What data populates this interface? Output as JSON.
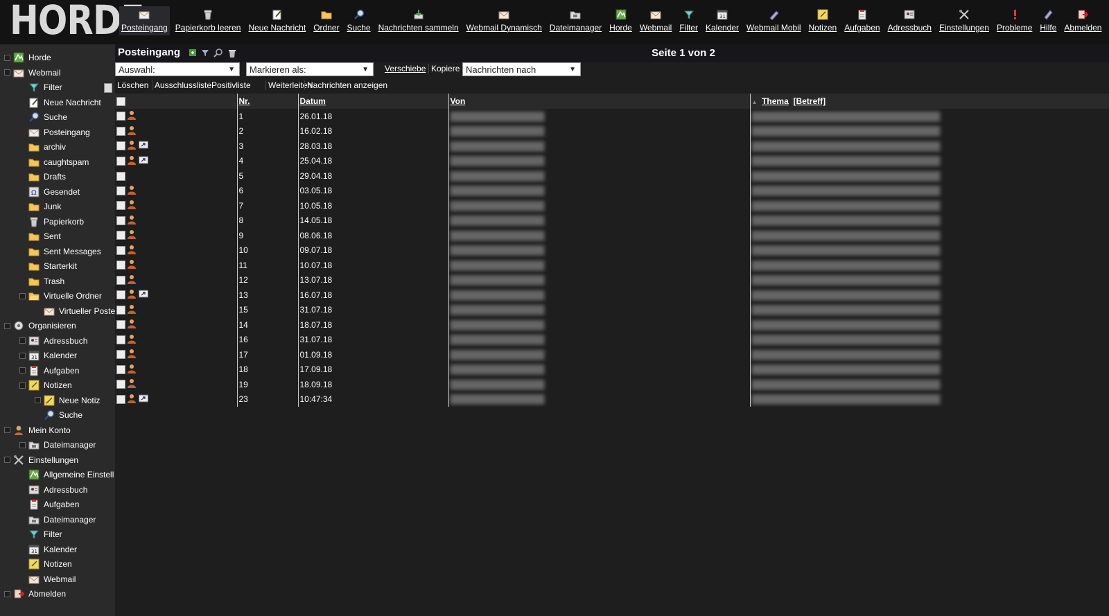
{
  "app": {
    "logo": "HORDE"
  },
  "toolbar": [
    {
      "label": "Posteingang",
      "icon": "inbox-icon",
      "active": true
    },
    {
      "label": "Papierkorb leeren",
      "icon": "trash-icon"
    },
    {
      "label": "Neue Nachricht",
      "icon": "compose-icon"
    },
    {
      "label": "Ordner",
      "icon": "folder-icon"
    },
    {
      "label": "Suche",
      "icon": "search-icon"
    },
    {
      "label": "Nachrichten sammeln",
      "icon": "fetch-icon"
    },
    {
      "label": "Webmail Dynamisch",
      "icon": "mail-icon"
    },
    {
      "label": "Dateimanager",
      "icon": "file-manager-icon"
    },
    {
      "label": "Horde",
      "icon": "horde-icon"
    },
    {
      "label": "Webmail",
      "icon": "mail-icon"
    },
    {
      "label": "Filter",
      "icon": "filter-icon"
    },
    {
      "label": "Kalender",
      "icon": "calendar-icon"
    },
    {
      "label": "Webmail Mobil",
      "icon": "mobile-icon"
    },
    {
      "label": "Notizen",
      "icon": "notes-icon"
    },
    {
      "label": "Aufgaben",
      "icon": "tasks-icon"
    },
    {
      "label": "Adressbuch",
      "icon": "addressbook-icon"
    },
    {
      "label": "Einstellungen",
      "icon": "settings-icon"
    },
    {
      "label": "Probleme",
      "icon": "problem-icon"
    },
    {
      "label": "Hilfe",
      "icon": "help-icon"
    },
    {
      "label": "Abmelden",
      "icon": "logout-icon"
    }
  ],
  "sidebar": [
    {
      "label": "Horde",
      "icon": "horde-icon",
      "level": 0,
      "toggle": true
    },
    {
      "label": "Webmail",
      "icon": "mail-icon",
      "level": 0,
      "toggle": true
    },
    {
      "label": "Filter",
      "icon": "filter-icon",
      "level": 1
    },
    {
      "label": "Neue Nachricht",
      "icon": "compose-icon",
      "level": 1
    },
    {
      "label": "Suche",
      "icon": "search-icon",
      "level": 1
    },
    {
      "label": "Posteingang",
      "icon": "inbox-icon",
      "level": 1
    },
    {
      "label": "archiv",
      "icon": "folder-icon",
      "level": 1
    },
    {
      "label": "caughtspam",
      "icon": "folder-icon",
      "level": 1
    },
    {
      "label": "Drafts",
      "icon": "folder-icon",
      "level": 1
    },
    {
      "label": "Gesendet",
      "icon": "sent-icon",
      "level": 1
    },
    {
      "label": "Junk",
      "icon": "folder-icon",
      "level": 1
    },
    {
      "label": "Papierkorb",
      "icon": "trash-icon",
      "level": 1
    },
    {
      "label": "Sent",
      "icon": "folder-icon",
      "level": 1
    },
    {
      "label": "Sent Messages",
      "icon": "folder-icon",
      "level": 1
    },
    {
      "label": "Starterkit",
      "icon": "folder-icon",
      "level": 1
    },
    {
      "label": "Trash",
      "icon": "folder-icon",
      "level": 1
    },
    {
      "label": "Virtuelle Ordner",
      "icon": "folder-open-icon",
      "level": 1,
      "toggle": true
    },
    {
      "label": "Virtueller Poste",
      "icon": "mail-icon",
      "level": 2
    },
    {
      "label": "Organisieren",
      "icon": "organize-icon",
      "level": 0,
      "toggle": true
    },
    {
      "label": "Adressbuch",
      "icon": "addressbook-icon",
      "level": 1,
      "toggle": true
    },
    {
      "label": "Kalender",
      "icon": "calendar-icon",
      "level": 1,
      "toggle": true
    },
    {
      "label": "Aufgaben",
      "icon": "tasks-icon",
      "level": 1,
      "toggle": true
    },
    {
      "label": "Notizen",
      "icon": "notes-icon",
      "level": 1,
      "toggle": true
    },
    {
      "label": "Neue Notiz",
      "icon": "new-note-icon",
      "level": 2,
      "toggle": true
    },
    {
      "label": "Suche",
      "icon": "search-icon",
      "level": 2
    },
    {
      "label": "Mein Konto",
      "icon": "account-icon",
      "level": 0,
      "toggle": true
    },
    {
      "label": "Dateimanager",
      "icon": "file-manager-icon",
      "level": 1,
      "toggle": true
    },
    {
      "label": "Einstellungen",
      "icon": "settings-icon",
      "level": 0,
      "toggle": true
    },
    {
      "label": "Allgemeine Einstell",
      "icon": "horde-icon",
      "level": 1
    },
    {
      "label": "Adressbuch",
      "icon": "addressbook-icon",
      "level": 1
    },
    {
      "label": "Aufgaben",
      "icon": "tasks-icon",
      "level": 1
    },
    {
      "label": "Dateimanager",
      "icon": "file-manager-icon",
      "level": 1
    },
    {
      "label": "Filter",
      "icon": "filter-icon",
      "level": 1
    },
    {
      "label": "Kalender",
      "icon": "calendar-icon",
      "level": 1
    },
    {
      "label": "Notizen",
      "icon": "notes-icon",
      "level": 1
    },
    {
      "label": "Webmail",
      "icon": "mail-icon",
      "level": 1
    },
    {
      "label": "Abmelden",
      "icon": "logout-icon",
      "level": 0,
      "toggle": true
    }
  ],
  "mailbox": {
    "title": "Posteingang",
    "page_info": "Seite 1 von 2",
    "select_label": "Auswahl:",
    "mark_label": "Markieren als:",
    "move_label": "Verschiebe",
    "copy_label": "Kopiere",
    "target_label": "Nachrichten nach",
    "actions": [
      "Löschen",
      "Ausschlussliste",
      "Positivliste",
      "Weiterleiten",
      "Nachrichten anzeigen"
    ],
    "columns": {
      "nr": "Nr.",
      "date": "Datum",
      "from": "Von",
      "subject": "Thema",
      "subject_alt": "[Betreff]"
    }
  },
  "messages": [
    {
      "nr": "1",
      "date": "26.01.18",
      "person": true,
      "fwd": false
    },
    {
      "nr": "2",
      "date": "16.02.18",
      "person": true,
      "fwd": false
    },
    {
      "nr": "3",
      "date": "28.03.18",
      "person": true,
      "fwd": true
    },
    {
      "nr": "4",
      "date": "25.04.18",
      "person": true,
      "fwd": true
    },
    {
      "nr": "5",
      "date": "29.04.18",
      "person": false,
      "fwd": false
    },
    {
      "nr": "6",
      "date": "03.05.18",
      "person": true,
      "fwd": false
    },
    {
      "nr": "7",
      "date": "10.05.18",
      "person": true,
      "fwd": false
    },
    {
      "nr": "8",
      "date": "14.05.18",
      "person": true,
      "fwd": false
    },
    {
      "nr": "9",
      "date": "08.06.18",
      "person": true,
      "fwd": false
    },
    {
      "nr": "10",
      "date": "09.07.18",
      "person": true,
      "fwd": false
    },
    {
      "nr": "11",
      "date": "10.07.18",
      "person": true,
      "fwd": false
    },
    {
      "nr": "12",
      "date": "13.07.18",
      "person": true,
      "fwd": false
    },
    {
      "nr": "13",
      "date": "16.07.18",
      "person": true,
      "fwd": true
    },
    {
      "nr": "15",
      "date": "31.07.18",
      "person": true,
      "fwd": false
    },
    {
      "nr": "14",
      "date": "18.07.18",
      "person": true,
      "fwd": false
    },
    {
      "nr": "16",
      "date": "31.07.18",
      "person": true,
      "fwd": false
    },
    {
      "nr": "17",
      "date": "01.09.18",
      "person": true,
      "fwd": false
    },
    {
      "nr": "18",
      "date": "17.09.18",
      "person": true,
      "fwd": false
    },
    {
      "nr": "19",
      "date": "18.09.18",
      "person": true,
      "fwd": false
    },
    {
      "nr": "23",
      "date": "10:47:34",
      "person": true,
      "fwd": true
    }
  ]
}
